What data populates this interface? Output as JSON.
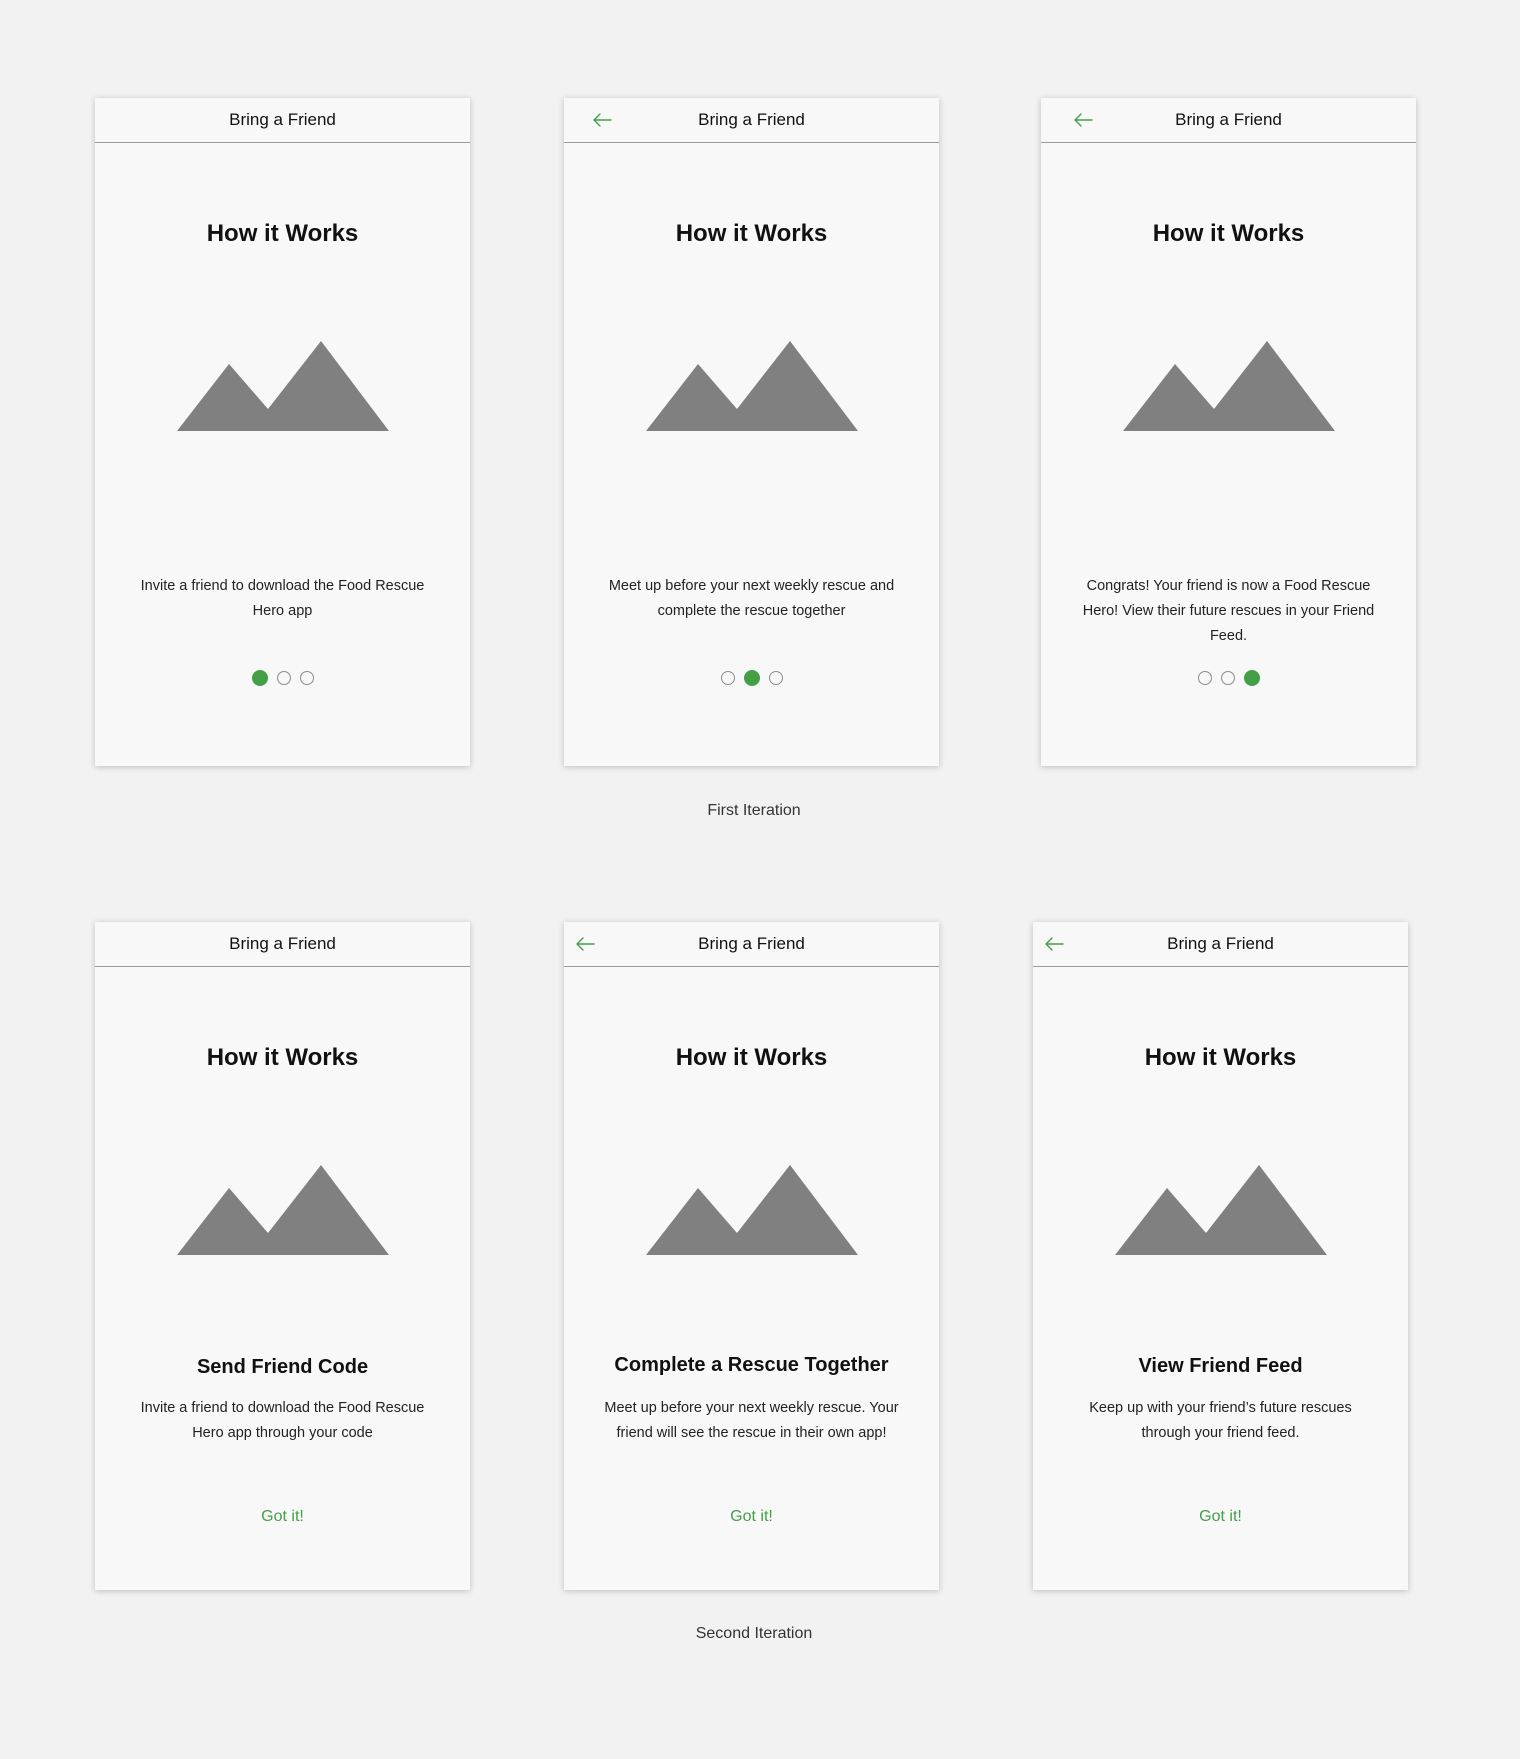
{
  "colors": {
    "background": "#f2f2f2",
    "card": "#f8f8f8",
    "accent_green": "#43a047",
    "placeholder_gray": "#808080"
  },
  "first_iteration": {
    "caption": "First Iteration",
    "screens": [
      {
        "header_title": "Bring a Friend",
        "has_back_arrow": false,
        "heading": "How it Works",
        "image": "mountain-placeholder-icon",
        "description": "Invite a friend to download the Food Rescue Hero app",
        "active_dot": 1,
        "dot_count": 3
      },
      {
        "header_title": "Bring a Friend",
        "has_back_arrow": true,
        "heading": "How it Works",
        "image": "mountain-placeholder-icon",
        "description": "Meet up before your next weekly rescue and complete the rescue together",
        "active_dot": 2,
        "dot_count": 3
      },
      {
        "header_title": "Bring a Friend",
        "has_back_arrow": true,
        "heading": "How it Works",
        "image": "mountain-placeholder-icon",
        "description": "Congrats! Your friend is now a Food Rescue Hero! View their future rescues in your Friend Feed.",
        "active_dot": 3,
        "dot_count": 3
      }
    ]
  },
  "second_iteration": {
    "caption": "Second Iteration",
    "screens": [
      {
        "header_title": "Bring a Friend",
        "has_back_arrow": false,
        "heading": "How it Works",
        "image": "mountain-placeholder-icon",
        "subtitle": "Send Friend Code",
        "description": "Invite a friend to download the Food Rescue Hero app through your code",
        "button_label": "Got it!"
      },
      {
        "header_title": "Bring a Friend",
        "has_back_arrow": true,
        "heading": "How it Works",
        "image": "mountain-placeholder-icon",
        "subtitle": "Complete a Rescue Together",
        "description": "Meet up before your next weekly rescue. Your friend will see the rescue in their own app!",
        "button_label": "Got it!"
      },
      {
        "header_title": "Bring a Friend",
        "has_back_arrow": true,
        "heading": "How it Works",
        "image": "mountain-placeholder-icon",
        "subtitle": "View Friend Feed",
        "description": "Keep up with your friend’s future rescues through your friend feed.",
        "button_label": "Got it!"
      }
    ]
  }
}
